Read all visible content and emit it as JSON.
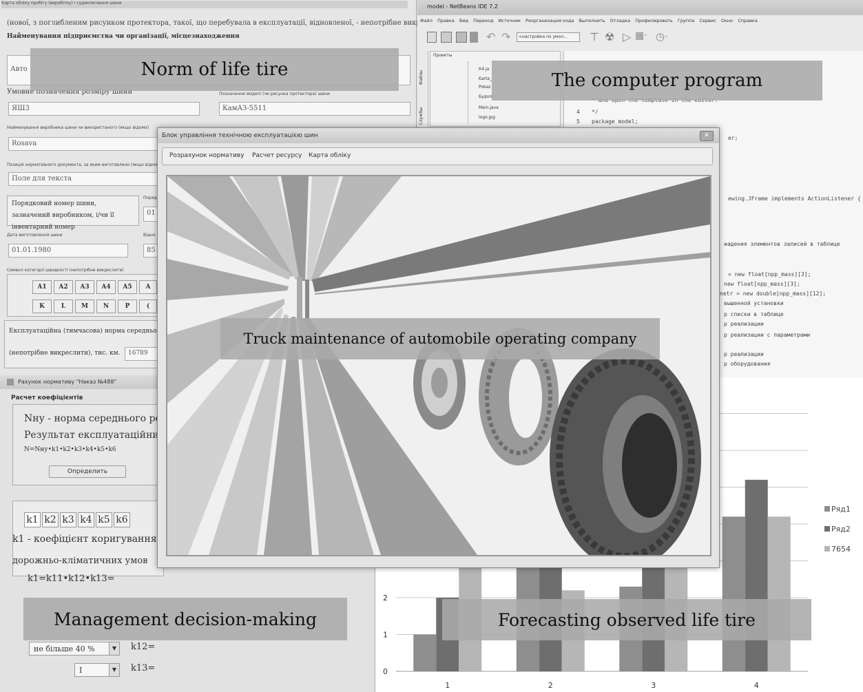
{
  "left_form": {
    "window_title": "Карта обліку пробігу (виробітку) і судиключення шини",
    "header_text": "(нової, з поглибленим рисунком протектора, такої, що перебувала в експлуатації, відновленої, - непотрібне викреслити)",
    "org_label": "Найменування підприємства чи організації, місцезнаходження",
    "org_value": "Авто",
    "size_label": "Умовне позначення розміру шини",
    "model_label": "Позначення моделі (чи рисунка протектора) шини",
    "size_value": "ЯШ3",
    "model_value": "КамАЗ-5511",
    "maker_label": "Найменування виробника шини чи використаного (якщо відомо)",
    "maker_value": "Rosava",
    "doc_label": "Позиція нормативного документа, за яким виготовлено (якщо відомо)",
    "doc_value": "Поле для текста",
    "serial_label": "Порядковий номер шини, зазначений виробником, і/чи її інвентарний номер",
    "serial_side_label": "Поряд",
    "serial_value": "01",
    "date_label": "Дата виготовлення шини",
    "date_side_label": "Відно",
    "date_value": "01.01.1980",
    "date_side_value": "85",
    "speed_label": "Символ категорії швидкості (непотрібне викреслити)",
    "speed_row1": [
      "A1",
      "A2",
      "A3",
      "A4",
      "A5",
      "A"
    ],
    "speed_row2": [
      "K",
      "L",
      "M",
      "N",
      "P",
      "("
    ],
    "norm_text1": "Експлуатаційна (тимчасова) норма середньог",
    "norm_text2": "(непотрібне викреслити), тис. км.",
    "norm_value": "16789"
  },
  "norm_window": {
    "title": "Рахунок нормативу \"Наказ №488\"",
    "section": "Расчет коефіцієнтів",
    "line1": "Nну - норма середнього рес",
    "line2": "Результат експлуатаційних",
    "formula": "N=Nну•k1•k2•k3•k4•k5•k6",
    "button": "Определить",
    "tabs": [
      "k1",
      "k2",
      "k3",
      "k4",
      "k5",
      "k6"
    ],
    "k1_text1": "k1 - коефіцієнт коригування",
    "k1_text2": "дорожньо-кліматичних умов",
    "k1_formula": "k1=k11•k12•k13=",
    "combo1": "не більше 40 %",
    "k12": "k12=",
    "combo2": "I",
    "k13": "k13="
  },
  "ide": {
    "title": "model - NetBeans IDE 7.2",
    "menu": [
      "Файл",
      "Правка",
      "Вид",
      "Переход",
      "Источник",
      "Реорганизация кода",
      "Выполнить",
      "Отладка",
      "Профилировать",
      "Группа",
      "Сервис",
      "Окно",
      "Справка"
    ],
    "config_combo": "<настройка по умол...",
    "projects_tab": "Проекты",
    "side_tabs": [
      "Файлы",
      "Службы"
    ],
    "tree_items": [
      "К4.ja",
      "Karta_",
      "Pokaz",
      "Будол",
      "Main.java",
      "logo.jpg"
    ],
    "code_lines": [
      {
        "num": "",
        "text": " * and open the template in the editor."
      },
      {
        "num": "4",
        "text": " */"
      },
      {
        "num": "5",
        "text": "package model;"
      },
      {
        "num": "",
        "text": "er;"
      },
      {
        "num": "",
        "text": "ewing.JFrame implements ActionListener {"
      },
      {
        "num": "",
        "text": "иадения элементов записей в таблице"
      },
      {
        "num": "",
        "text": "= new float[npp_mass][3];"
      },
      {
        "num": "",
        "text": "new float[npp_mass][3];"
      },
      {
        "num": "",
        "text": "netr = new double[npp_mass][12];"
      },
      {
        "num": "",
        "text": "вышенной установки"
      },
      {
        "num": "",
        "text": "р списки в таблице"
      },
      {
        "num": "",
        "text": "р реализации"
      },
      {
        "num": "",
        "text": "р реализации с параметрами"
      },
      {
        "num": "",
        "text": "р реализации"
      },
      {
        "num": "",
        "text": "р оборудования"
      }
    ]
  },
  "main_window": {
    "title": "Блок управління технічною експлуатацією шин",
    "menu": [
      "Розрахунок нормативу",
      "Расчет ресурсу",
      "Карта обліку"
    ]
  },
  "overlays": {
    "norm": "Norm of life tire",
    "program": "The computer program",
    "truck": "Truck maintenance of automobile operating company",
    "management": "Management decision-making",
    "forecast": "Forecasting observed life tire"
  },
  "chart_data": {
    "type": "bar",
    "categories": [
      "1",
      "2",
      "3",
      "4"
    ],
    "series": [
      {
        "name": "Ряд1",
        "values": [
          1,
          3.2,
          2.3,
          4.2
        ],
        "color": "#8e8e8e"
      },
      {
        "name": "Ряд2",
        "values": [
          2,
          3.8,
          3.4,
          5.2
        ],
        "color": "#6e6e6e"
      },
      {
        "name": "7654",
        "values": [
          3.1,
          2.2,
          3.6,
          4.2
        ],
        "color": "#b6b6b6"
      }
    ],
    "y_ticks": [
      "0",
      "1",
      "2"
    ],
    "ylim": [
      0,
      8
    ],
    "grid": true,
    "legend": "right"
  }
}
